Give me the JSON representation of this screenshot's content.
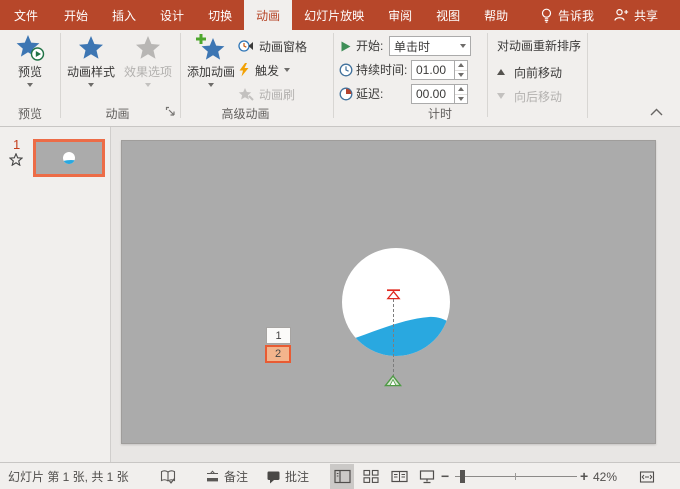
{
  "colors": {
    "titlebar_red": "#B7472A",
    "selection_orange": "#ED6C47",
    "star_blue": "#3D76B3",
    "wave_blue": "#29A8E0",
    "slide_gray": "#ABABAB"
  },
  "menu": {
    "tabs": [
      {
        "label": "文件"
      },
      {
        "label": "开始"
      },
      {
        "label": "插入"
      },
      {
        "label": "设计"
      },
      {
        "label": "切换"
      },
      {
        "label": "动画"
      },
      {
        "label": "幻灯片放映"
      },
      {
        "label": "审阅"
      },
      {
        "label": "视图"
      },
      {
        "label": "帮助"
      }
    ],
    "active_tab": "动画",
    "tell_me": "告诉我",
    "share": "共享"
  },
  "ribbon": {
    "preview": {
      "button": "预览",
      "group_label": "预览"
    },
    "animation": {
      "styles": "动画样式",
      "effect_options": "效果选项",
      "group_label": "动画"
    },
    "advanced": {
      "add_animation": "添加动画",
      "animation_pane": "动画窗格",
      "trigger": "触发",
      "animation_painter": "动画刷",
      "group_label": "高级动画"
    },
    "timing": {
      "start_label": "开始:",
      "start_value": "单击时",
      "duration_label": "持续时间:",
      "duration_value": "01.00",
      "delay_label": "延迟:",
      "delay_value": "00.00",
      "group_label": "计时",
      "reorder_header": "对动画重新排序",
      "move_earlier": "向前移动",
      "move_later": "向后移动"
    }
  },
  "slide_panel": {
    "slide_number": "1"
  },
  "slide": {
    "badges": [
      "1",
      "2"
    ]
  },
  "status_bar": {
    "slide_info": "幻灯片 第 1 张, 共 1 张",
    "notes": "备注",
    "comments": "批注",
    "zoom": "42%"
  },
  "icons": {
    "lightbulb-icon": "tell-me bulb",
    "person-icon": "share person",
    "preview-star-icon": "blue star with play badge",
    "animation-style-star-icon": "blue star",
    "effect-options-star-icon": "gray star (disabled)",
    "add-animation-star-icon": "blue star with green plus",
    "animation-pane-icon": "clock with pane arrow",
    "trigger-icon": "yellow lightning bolt",
    "animation-painter-icon": "gray star brush (disabled)",
    "start-play-icon": "green play triangle",
    "duration-clock-icon": "clock outline",
    "delay-clock-icon": "clock with red wedge",
    "spellcheck-icon": "book with check",
    "notes-icon": "notes bar",
    "comments-icon": "speech bubble",
    "normal-view-icon": "normal view",
    "slide-sorter-icon": "grid of slides",
    "reading-view-icon": "reading book",
    "slideshow-icon": "projection screen",
    "fit-window-icon": "fit slide to window",
    "motion-path-start-icon": "green triangle",
    "motion-path-end-icon": "red arrow stop"
  }
}
